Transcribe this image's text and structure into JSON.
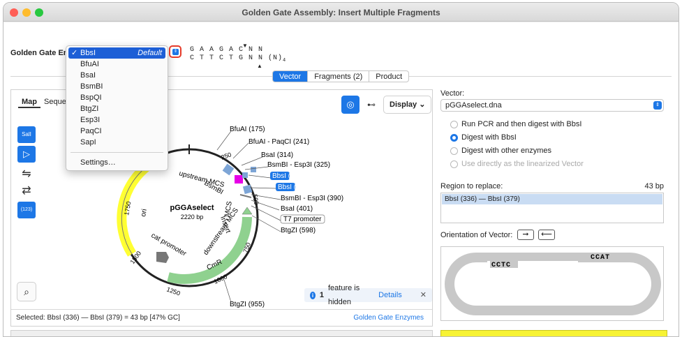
{
  "window": {
    "title": "Golden Gate Assembly: Insert Multiple Fragments"
  },
  "colors": {
    "accent": "#1d77e6",
    "ori": "#ffff00",
    "cmr": "#8fd18f",
    "mcs": "#e600e6"
  },
  "enzyme_label": "Golden Gate En",
  "sequence": {
    "top": "G A A G A C N N",
    "bottom": "C T T C T G N N (N)",
    "subscript": "4"
  },
  "enzyme_dropdown": {
    "selected": "BbsI",
    "default_tag": "Default",
    "options": [
      "BbsI",
      "BfuAI",
      "BsaI",
      "BsmBI",
      "BspQI",
      "BtgZI",
      "Esp3I",
      "PaqCI",
      "SapI"
    ],
    "settings": "Settings…"
  },
  "main_tabs": [
    "Vector",
    "Fragments (2)",
    "Product"
  ],
  "map_panel": {
    "subtabs": [
      "Map",
      "Seque"
    ],
    "left_icons": [
      "SalI",
      "feature-icon",
      "parallel-icon",
      "swap-icon",
      "(123)"
    ],
    "display_label": "Display",
    "plasmid_name": "pGGAselect",
    "plasmid_size": "2220 bp",
    "ticks": [
      "250",
      "500",
      "750",
      "1000",
      "1250",
      "1500",
      "1750"
    ],
    "features": [
      "ori",
      "CmR",
      "cat promoter",
      "upstream MCS",
      "downstream MCS",
      "MCS",
      "Insert",
      "T7 promoter"
    ],
    "sites": [
      "BfuAI  (175)",
      "BfuAI - PaqCI  (241)",
      "BsaI  (314)",
      "BsmBI - Esp3I  (325)",
      "BbsI  (336)",
      "BbsI  (379)",
      "BsmBI - Esp3I  (390)",
      "BsaI  (401)",
      "BtgZI  (598)",
      "BtgZI  (955)",
      "BsmBI"
    ],
    "hidden_note": {
      "count": "1",
      "text": "feature is hidden",
      "link": "Details"
    },
    "status": "Selected:  BbsI  (336)  —  BbsI  (379)  =  43 bp     [47% GC]",
    "status_link": "Golden Gate Enzymes"
  },
  "vector_panel": {
    "vector_label": "Vector:",
    "vector_value": "pGGAselect.dna",
    "options": [
      {
        "label": "Run PCR and then digest with BbsI",
        "checked": false,
        "disabled": false
      },
      {
        "label": "Digest with BbsI",
        "checked": true,
        "disabled": false
      },
      {
        "label": "Digest with other enzymes",
        "checked": false,
        "disabled": false
      },
      {
        "label": "Use directly as the linearized Vector",
        "checked": false,
        "disabled": true
      }
    ],
    "region_label": "Region to replace:",
    "region_size": "43 bp",
    "region_value": "BbsI  (336)  —  BbsI  (379)",
    "orientation_label": "Orientation of Vector:",
    "overhang_left": "CCTC",
    "overhang_right": "CCAT"
  }
}
